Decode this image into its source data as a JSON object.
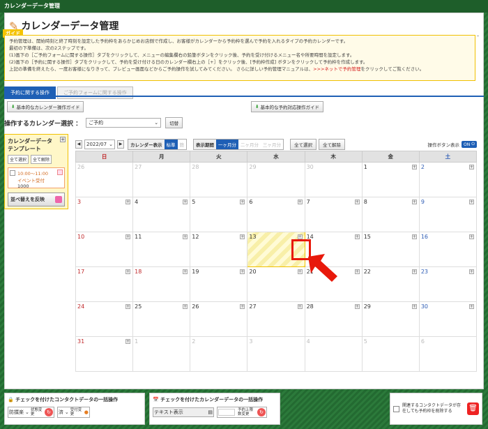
{
  "titlebar": "カレンダーデータ管理",
  "page_title": "カレンダーデータ管理",
  "guide": {
    "tag": "ガイド",
    "lines": [
      "予約管理は、開始時刻と終了時刻を設定した予約枠をあらかじめお店側で作成し、お客様がカレンダーから予約枠を選んで予約を入れるタイプの予約カレンダーです。",
      "最初の下準備は、次の2ステップです。",
      "(1)画下の［ご予約フォームに関する操作］タブをクリックして、メニューの編集欄右の鉛筆ボタンをクリック後、予約を受け付けるメニュー名や所要時間を設定します。",
      "(2)画下の［予約に関する操作］タブをクリックして、予約を受け付ける日のカレンダー欄右上の［+］をクリック後、[予約枠作成] ボタンをクリックして予約枠を作成します。",
      "上記の準備を終えたら、一度お客様になりきって、プレビュー画面などからご予約操作を試してみてください。 さらに詳しい予約管理マニュアルは、"
    ],
    "link": ">>>ネットで予約管理",
    "tail": "をクリックしてご覧ください。"
  },
  "tabs": [
    {
      "label": "予約に関する操作"
    },
    {
      "label": "ご予約フォームに関する操作"
    }
  ],
  "buttons": {
    "basic_guide": "基本的なカレンダー操作ガイド",
    "reserve_guide": "基本的な予約対応操作ガイド"
  },
  "calendar_select": {
    "label": "操作するカレンダー選択 ：",
    "value": "ご予約",
    "change": "切替"
  },
  "template": {
    "title1": "カレンダーデータ",
    "title2": "テンプレート",
    "select_all": "全て選択",
    "deselect_all": "全て解除",
    "event_time": "10:00～11:00",
    "event_name": "イベント受付",
    "event_value": "1000",
    "reflect": "並べ替えを反映"
  },
  "calbar": {
    "month": "2022/07",
    "display_label": "カレンダー表示",
    "display_on": "标準",
    "display_off": "簡",
    "period_label": "表示期間",
    "p1": "一ヶ月分",
    "p2": "二ヶ月分",
    "p3": "三ヶ月分",
    "select_all": "全て選択",
    "deselect_all": "全て解除",
    "op_toggle_label": "操作ボタン表示",
    "toggle": "ON"
  },
  "weekdays": [
    "日",
    "月",
    "火",
    "水",
    "木",
    "金",
    "土"
  ],
  "weeks": [
    [
      "26",
      "27",
      "28",
      "29",
      "30",
      "1",
      "2"
    ],
    [
      "3",
      "4",
      "5",
      "6",
      "7",
      "8",
      "9"
    ],
    [
      "10",
      "11",
      "12",
      "13",
      "14",
      "15",
      "16"
    ],
    [
      "17",
      "18",
      "19",
      "20",
      "21",
      "22",
      "23"
    ],
    [
      "24",
      "25",
      "26",
      "27",
      "28",
      "29",
      "30"
    ],
    [
      "31",
      "1",
      "2",
      "3",
      "4",
      "5",
      "6"
    ]
  ],
  "bottom": {
    "contact_title": "チェックを付けたコンタクトデータの一括操作",
    "status_value": "防撲楽",
    "status_label": "状態変更",
    "accept_value": "済",
    "accept_label": "受付変更",
    "calendar_title": "チェックを付けたカレンダーデータの一括操作",
    "text_display": "テキスト表示",
    "slot_label": "予約上限数変更",
    "delete_note": "関連するコンタクトデータが存在しても予約枠を削除する"
  },
  "colors": {
    "accent": "#1e5fb5",
    "border_green": "#2c7a3b",
    "highlight": "#e8190b"
  }
}
